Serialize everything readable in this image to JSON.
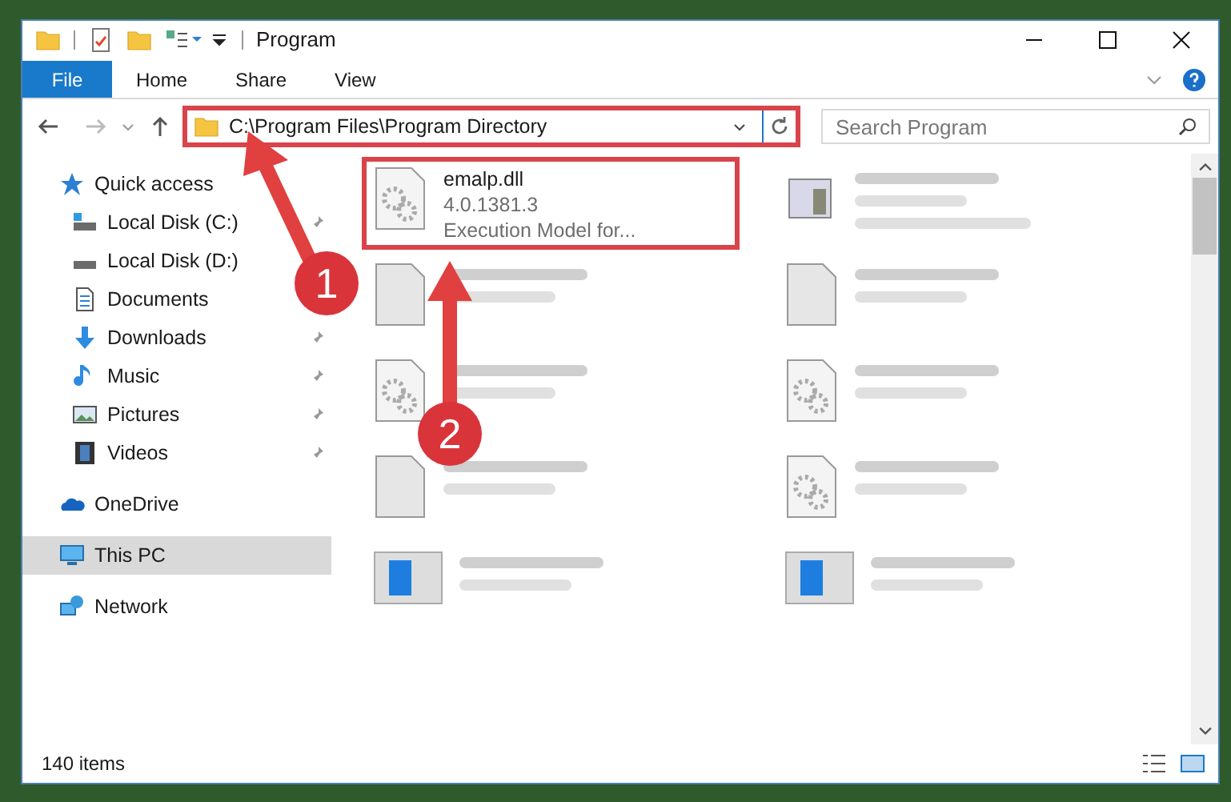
{
  "window": {
    "title": "Program"
  },
  "ribbon": {
    "tabs": [
      {
        "label": "File",
        "selected": true
      },
      {
        "label": "Home",
        "selected": false
      },
      {
        "label": "Share",
        "selected": false
      },
      {
        "label": "View",
        "selected": false
      }
    ]
  },
  "address_bar": {
    "path": "C:\\Program Files\\Program Directory",
    "highlighted": true
  },
  "search": {
    "placeholder": "Search Program"
  },
  "sidebar": {
    "items": [
      {
        "kind": "group",
        "label": "Quick access",
        "selected": false
      },
      {
        "kind": "item",
        "label": "Local Disk (C:)",
        "pinned": true,
        "selected": false
      },
      {
        "kind": "item",
        "label": "Local Disk (D:)",
        "pinned": false,
        "selected": false
      },
      {
        "kind": "item",
        "label": "Documents",
        "pinned": false,
        "selected": false
      },
      {
        "kind": "item",
        "label": "Downloads",
        "pinned": true,
        "selected": false
      },
      {
        "kind": "item",
        "label": "Music",
        "pinned": true,
        "selected": false
      },
      {
        "kind": "item",
        "label": "Pictures",
        "pinned": true,
        "selected": false
      },
      {
        "kind": "item",
        "label": "Videos",
        "pinned": true,
        "selected": false
      },
      {
        "kind": "group",
        "label": "OneDrive",
        "selected": false
      },
      {
        "kind": "group",
        "label": "This PC",
        "selected": true
      },
      {
        "kind": "group",
        "label": "Network",
        "selected": false
      }
    ]
  },
  "files": [
    {
      "kind": "dll",
      "name": "emalp.dll",
      "details": [
        "4.0.1381.3",
        "Execution Model for..."
      ],
      "blurred": false,
      "highlighted": true
    },
    {
      "kind": "exe",
      "blurred": true
    },
    {
      "kind": "doc",
      "blurred": true
    },
    {
      "kind": "doc",
      "blurred": true
    },
    {
      "kind": "dll",
      "blurred": true
    },
    {
      "kind": "dll",
      "blurred": true
    },
    {
      "kind": "doc",
      "blurred": true
    },
    {
      "kind": "dll",
      "blurred": true
    },
    {
      "kind": "app",
      "blurred": true
    },
    {
      "kind": "app",
      "blurred": true
    }
  ],
  "status_bar": {
    "item_count": "140 items"
  },
  "annotations": [
    {
      "label": "1"
    },
    {
      "label": "2"
    }
  ]
}
